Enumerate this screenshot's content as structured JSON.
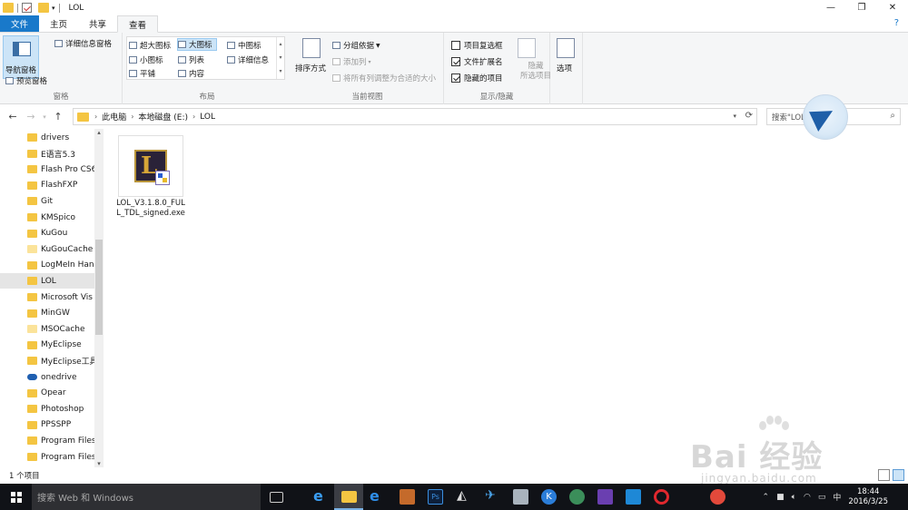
{
  "window": {
    "title": "LOL",
    "controls": {
      "minimize": "—",
      "maximize": "❐",
      "close": "✕"
    }
  },
  "ribbon": {
    "tabs": [
      "文件",
      "主页",
      "共享",
      "查看"
    ],
    "active_tab": "查看",
    "help": "?",
    "pane": {
      "navigation_pane": "导航窗格",
      "preview_pane": "预览窗格",
      "details_pane": "详细信息窗格",
      "group_label": "窗格"
    },
    "layout": {
      "options": [
        "超大图标",
        "大图标",
        "中图标",
        "小图标",
        "列表",
        "详细信息",
        "平铺",
        "内容"
      ],
      "selected": "大图标",
      "group_label": "布局"
    },
    "current_view": {
      "sort_by": "排序方式",
      "group_by": "分组依据",
      "add_columns": "添加列",
      "size_all_columns": "将所有列调整为合适的大小",
      "group_label": "当前视图"
    },
    "show_hide": {
      "item_checkboxes": "项目复选框",
      "item_checkboxes_checked": false,
      "file_name_extensions": "文件扩展名",
      "file_name_extensions_checked": true,
      "hidden_items": "隐藏的项目",
      "hidden_items_checked": true,
      "hide_selected_line1": "隐藏",
      "hide_selected_line2": "所选项目",
      "group_label": "显示/隐藏"
    },
    "options": "选项"
  },
  "address": {
    "breadcrumb": [
      "此电脑",
      "本地磁盘 (E:)",
      "LOL"
    ],
    "search_placeholder": "搜索\"LOL\""
  },
  "nav_tree": [
    {
      "label": "drivers",
      "icon": "folder"
    },
    {
      "label": "E语言5.3",
      "icon": "folder"
    },
    {
      "label": "Flash Pro CS6",
      "icon": "folder"
    },
    {
      "label": "FlashFXP",
      "icon": "folder"
    },
    {
      "label": "Git",
      "icon": "folder"
    },
    {
      "label": "KMSpico",
      "icon": "folder"
    },
    {
      "label": "KuGou",
      "icon": "folder"
    },
    {
      "label": "KuGouCache",
      "icon": "folder-pale"
    },
    {
      "label": "LogMeIn Han",
      "icon": "folder"
    },
    {
      "label": "LOL",
      "icon": "folder",
      "selected": true
    },
    {
      "label": "Microsoft Vis",
      "icon": "folder"
    },
    {
      "label": "MinGW",
      "icon": "folder"
    },
    {
      "label": "MSOCache",
      "icon": "folder-pale"
    },
    {
      "label": "MyEclipse",
      "icon": "folder"
    },
    {
      "label": "MyEclipse工具",
      "icon": "folder"
    },
    {
      "label": "onedrive",
      "icon": "cloud"
    },
    {
      "label": "Opear",
      "icon": "folder"
    },
    {
      "label": "Photoshop",
      "icon": "folder"
    },
    {
      "label": "PPSSPP",
      "icon": "folder"
    },
    {
      "label": "Program Files",
      "icon": "folder"
    },
    {
      "label": "Program Files",
      "icon": "folder"
    }
  ],
  "files": [
    {
      "name": "LOL_V3.1.8.0_FULL_TDL_signed.exe",
      "icon": "lol-installer-icon"
    }
  ],
  "status": {
    "item_count": "1 个项目"
  },
  "taskbar": {
    "search_placeholder": "搜索 Web 和 Windows",
    "time": "18:44",
    "date": "2016/3/25",
    "ime": "中"
  },
  "watermark": {
    "text": "Bai 经验",
    "sub": "jingyan.baidu.com"
  },
  "colors": {
    "accent": "#1979ca",
    "selected_bg": "#cce4f7",
    "folder": "#f4c542",
    "taskbar": "#101217"
  }
}
